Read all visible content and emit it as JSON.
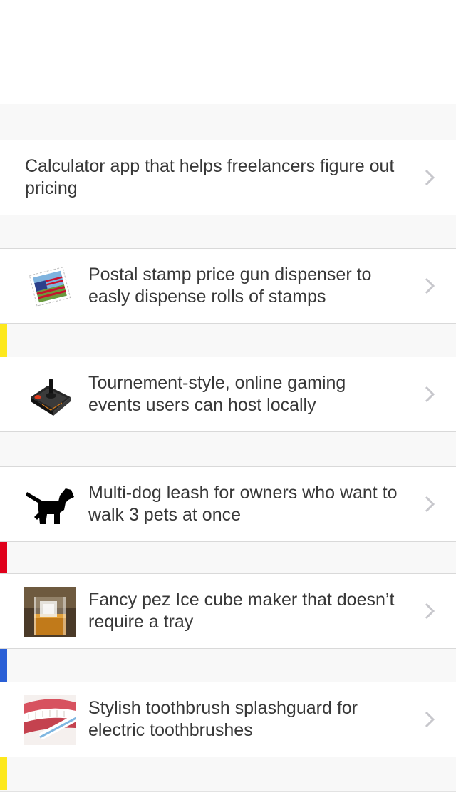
{
  "colors": {
    "background": "#f8f8f8",
    "row_background": "#ffffff",
    "divider": "#d9d9d9",
    "text": "#383838",
    "chevron": "#c7c7cc",
    "accent_yellow": "#fde81d",
    "accent_red": "#e0001b",
    "accent_blue": "#2a5fd6"
  },
  "ideas": [
    {
      "title": "Calculator app that helps freelancers figure out pricing",
      "icon": "none"
    },
    {
      "title": "Postal stamp price gun dispenser to easly dispense rolls of stamps",
      "icon": "postage-stamp-icon",
      "accent": "yellow"
    },
    {
      "title": "Tournement-style, online gaming events users can host locally",
      "icon": "joystick-icon",
      "accent": "yellow"
    },
    {
      "title": "Multi-dog leash for owners who want to walk 3 pets at once",
      "icon": "dog-walking-icon",
      "accent": "red"
    },
    {
      "title": "Fancy pez Ice cube maker that doesn’t require a tray",
      "icon": "ice-cube-glass-photo",
      "accent": "blue"
    },
    {
      "title": "Stylish toothbrush splashguard for electric toothbrushes",
      "icon": "toothbrush-photo",
      "accent": "yellow"
    }
  ]
}
